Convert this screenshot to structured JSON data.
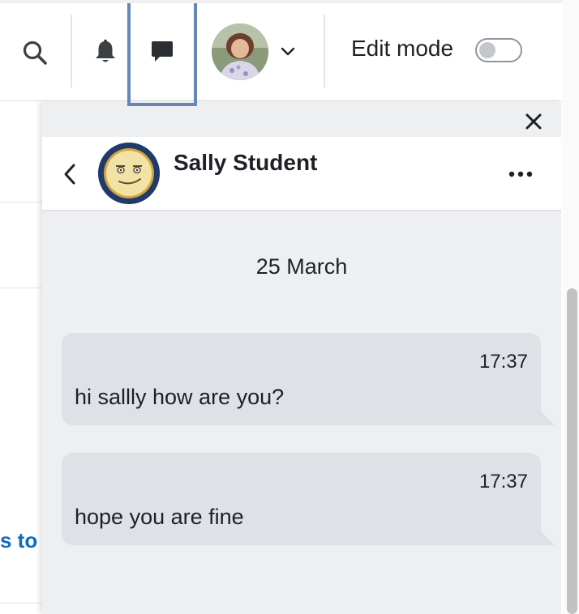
{
  "navbar": {
    "edit_mode_label": "Edit mode",
    "edit_mode_on": false,
    "icons": {
      "search": "search-icon",
      "notifications": "bell-icon",
      "messages": "message-bubble-icon",
      "user_menu": "chevron-down-icon"
    }
  },
  "background_page": {
    "link_fragment": "s to"
  },
  "drawer": {
    "close_icon": "close-icon",
    "conversation": {
      "contact_name": "Sally Student",
      "back_icon": "chevron-left-icon",
      "more_icon": "more-options-icon"
    },
    "day_label": "25 March",
    "messages": [
      {
        "time": "17:37",
        "text": "hi sallly how are you?"
      },
      {
        "time": "17:37",
        "text": "hope you are fine"
      }
    ]
  },
  "colors": {
    "focus_outline": "#6589b6",
    "bubble": "#dee1e6",
    "drawer_bg": "#eeeff1",
    "link": "#0f6cbf"
  }
}
